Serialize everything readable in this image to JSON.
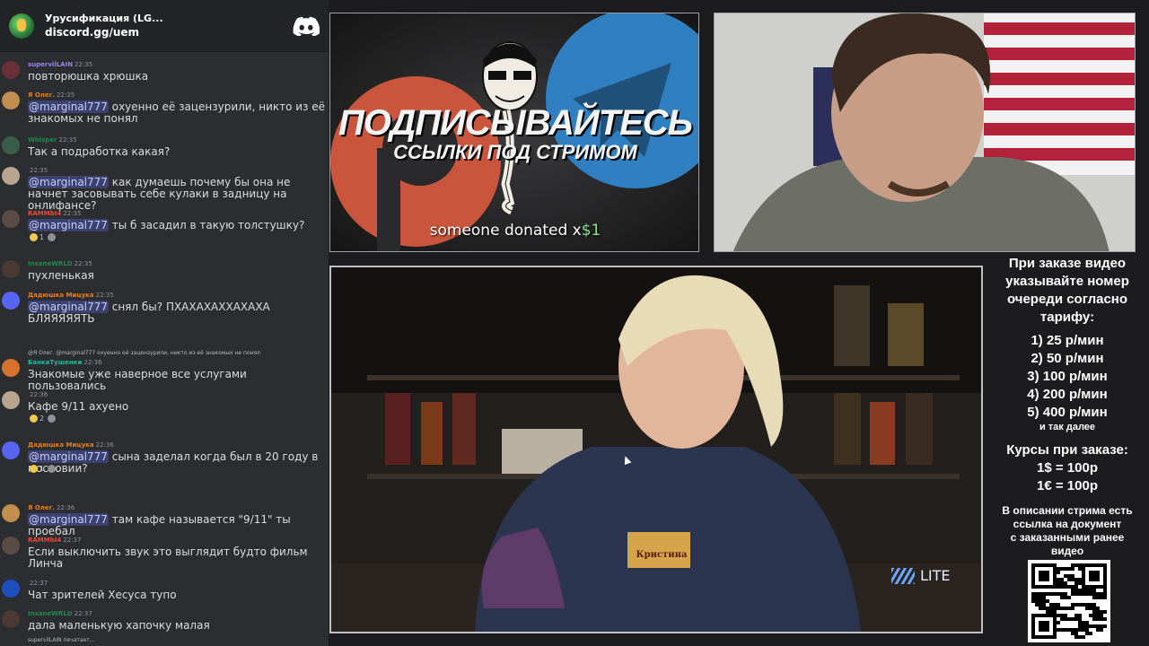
{
  "chat": {
    "server_name": "Урусификация (LG...",
    "server_invite": "discord.gg/uem",
    "typing": "supervilLAIN печатает...",
    "messages": [
      {
        "user": "supervilLAIN",
        "time": "22:35",
        "ucolor": "#9b84ee",
        "acolor": "#6b2f3a",
        "text": "повторюшка хрюшка"
      },
      {
        "user": "Я Олег.",
        "time": "22:35",
        "ucolor": "#e67e22",
        "acolor": "#c28e4d",
        "mention": "@marginal777",
        "text": " охуенно её зацензурили, никто из её знакомых не понял"
      },
      {
        "user": "Whisper",
        "time": "22:35",
        "ucolor": "#1f8b4c",
        "acolor": "#3b5e4b",
        "text": "Так а подработка какая?"
      },
      {
        "user": "",
        "time": "22:35",
        "ucolor": "#8e9297",
        "acolor": "#b8a58f",
        "mention": "@marginal777",
        "text": " как думаешь почему бы она не начнет засовывать себе кулаки в задницу на онлифансе?"
      },
      {
        "user": "RAMMbI4",
        "time": "22:35",
        "ucolor": "#e74c3c",
        "acolor": "#5b4b45",
        "mention": "@marginal777",
        "text": " ты б засадил в такую толстушку?",
        "reacts": [
          {
            "count": "1",
            "grey": false
          },
          {
            "count": "",
            "grey": true
          }
        ]
      },
      {
        "user": "InsaneWRLD",
        "time": "22:35",
        "ucolor": "#1f8b4c",
        "acolor": "#4a3a33",
        "text": "пухленькая"
      },
      {
        "user": "Дядюшка Мицука",
        "time": "22:35",
        "ucolor": "#e67e22",
        "acolor": "#5865f2",
        "mention": "@marginal777",
        "text": " снял бы? ПХАХАХАХХАХАХА БЛЯЯЯЯЯТЬ"
      },
      {
        "user": "БанкаТушенки",
        "time": "22:36",
        "ucolor": "#1abc9c",
        "acolor": "#d8702e",
        "reply": "@Я Олег. @marginal777 охуенно её зацензурили, никто из её знакомых не понял",
        "text": "Знакомые уже наверное все услугами пользовались"
      },
      {
        "user": "",
        "time": "22:36",
        "ucolor": "#8e9297",
        "acolor": "#b8a58f",
        "text": "Кафе 9/11 ахуено",
        "reacts": [
          {
            "count": "2",
            "grey": false
          },
          {
            "count": "",
            "grey": true
          }
        ]
      },
      {
        "user": "Дядюшка Мицука",
        "time": "22:36",
        "ucolor": "#e67e22",
        "acolor": "#5865f2",
        "mention": "@marginal777",
        "text": " сына заделал когда был в 20 году в московии?",
        "reacts": [
          {
            "count": "1",
            "grey": false
          },
          {
            "count": "",
            "grey": true
          }
        ]
      },
      {
        "user": "Я Олег.",
        "time": "22:36",
        "ucolor": "#e67e22",
        "acolor": "#c28e4d",
        "mention": "@marginal777",
        "text": " там кафе называется \"9/11\" ты проебал"
      },
      {
        "user": "RAMMbI4",
        "time": "22:37",
        "ucolor": "#e74c3c",
        "acolor": "#5b4b45",
        "text": "Если выключить звук это выглядит будто фильм Линча"
      },
      {
        "user": "",
        "time": "22:37",
        "ucolor": "#f1c40f",
        "acolor": "#1f4fbf",
        "text": "Чат зрителей Хесуса тупо"
      },
      {
        "user": "InsaneWRLD",
        "time": "22:37",
        "ucolor": "#1f8b4c",
        "acolor": "#4a3a33",
        "text": "дала маленькую хапочку малая"
      }
    ]
  },
  "promo": {
    "headline": "ПОДПИСЫВАЙТЕСЬ",
    "subline": "ССЫЛКИ ПОД СТРИМОМ",
    "donation_prefix": "someone donated x",
    "donation_amount": "$1"
  },
  "video": {
    "badge": "Кристина",
    "watermark": "LITE"
  },
  "info": {
    "intro": [
      "При заказе видео",
      "указывайте номер",
      "очереди согласно",
      "тарифу:"
    ],
    "tariffs": [
      "1) 25 р/мин",
      "2) 50 р/мин",
      "3) 100 р/мин",
      "4) 200 р/мин",
      "5) 400 р/мин"
    ],
    "tariff_more": "и так далее",
    "rates_title": "Курсы при заказе:",
    "rates": [
      "1$ = 100р",
      "1€ = 100р"
    ],
    "description": [
      "В описании стрима есть",
      "ссылка на документ",
      "с заказанными ранее",
      "видео"
    ]
  },
  "colors": {
    "accent_donation": "#8be28b",
    "mention_bg": "#3c4270",
    "discord_blurple": "#5865f2"
  }
}
